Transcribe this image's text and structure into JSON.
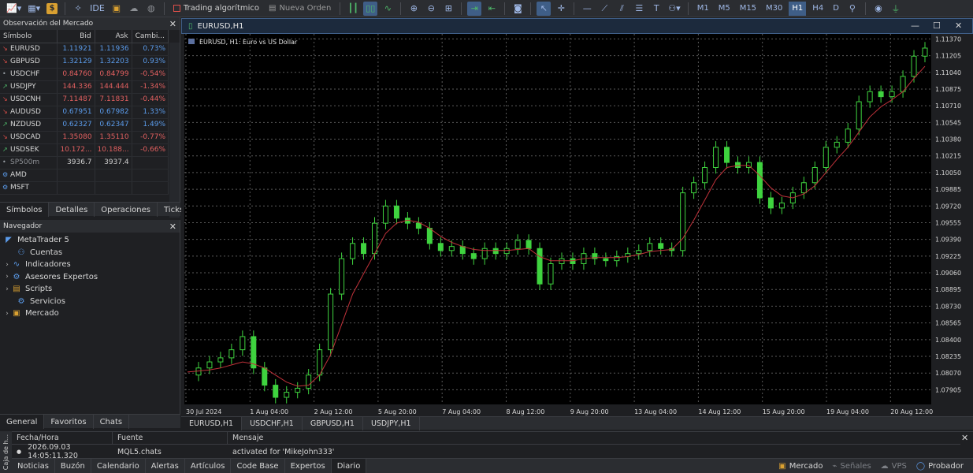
{
  "toolbar": {
    "algo_trading": "Trading algorítmico",
    "new_order": "Nueva Orden",
    "ide_label": "IDE",
    "timeframes": [
      "M1",
      "M5",
      "M15",
      "M30",
      "H1",
      "H4",
      "D"
    ],
    "active_timeframe": "H1"
  },
  "market_watch": {
    "title": "Observación del Mercado",
    "columns": [
      "Símbolo",
      "Bid",
      "Ask",
      "Cambi..."
    ],
    "rows": [
      {
        "symbol": "EURUSD",
        "dir": "down",
        "bid": "1.11921",
        "ask": "1.11936",
        "change": "0.73%",
        "color": "blue"
      },
      {
        "symbol": "GBPUSD",
        "dir": "down",
        "bid": "1.32129",
        "ask": "1.32203",
        "change": "0.93%",
        "color": "blue"
      },
      {
        "symbol": "USDCHF",
        "dir": "dot",
        "bid": "0.84760",
        "ask": "0.84799",
        "change": "-0.54%",
        "color": "red"
      },
      {
        "symbol": "USDJPY",
        "dir": "up",
        "bid": "144.336",
        "ask": "144.444",
        "change": "-1.34%",
        "color": "red"
      },
      {
        "symbol": "USDCNH",
        "dir": "down",
        "bid": "7.11487",
        "ask": "7.11831",
        "change": "-0.44%",
        "color": "red"
      },
      {
        "symbol": "AUDUSD",
        "dir": "down",
        "bid": "0.67951",
        "ask": "0.67982",
        "change": "1.33%",
        "color": "blue"
      },
      {
        "symbol": "NZDUSD",
        "dir": "up",
        "bid": "0.62327",
        "ask": "0.62347",
        "change": "1.49%",
        "color": "blue"
      },
      {
        "symbol": "USDCAD",
        "dir": "down",
        "bid": "1.35080",
        "ask": "1.35110",
        "change": "-0.77%",
        "color": "red"
      },
      {
        "symbol": "USDSEK",
        "dir": "up",
        "bid": "10.172...",
        "ask": "10.188...",
        "change": "-0.66%",
        "color": "red"
      },
      {
        "symbol": "SP500m",
        "dir": "dot",
        "bid": "3936.7",
        "ask": "3937.4",
        "change": "",
        "color": "gray"
      },
      {
        "symbol": "AMD",
        "dir": "circle",
        "bid": "",
        "ask": "",
        "change": "",
        "color": "gray"
      },
      {
        "symbol": "MSFT",
        "dir": "circle",
        "bid": "",
        "ask": "",
        "change": "",
        "color": "gray"
      }
    ],
    "tabs": [
      "Símbolos",
      "Detalles",
      "Operaciones",
      "Ticks"
    ]
  },
  "navigator": {
    "title": "Navegador",
    "root": "MetaTrader 5",
    "items": [
      "Cuentas",
      "Indicadores",
      "Asesores Expertos",
      "Scripts",
      "Servicios",
      "Mercado"
    ],
    "tabs": [
      "General",
      "Favoritos",
      "Chats"
    ]
  },
  "chart": {
    "window_title": "EURUSD,H1",
    "legend": "EURUSD, H1:  Euro vs US Dollar",
    "tabs": [
      "EURUSD,H1",
      "USDCHF,H1",
      "GBPUSD,H1",
      "USDJPY,H1"
    ],
    "candle_color": "#3fd33f",
    "ma_color": "#c0323a"
  },
  "chart_data": {
    "type": "line",
    "title": "",
    "x_tick_labels": [
      "30 Jul 2024",
      "1 Aug 04:00",
      "2 Aug 12:00",
      "5 Aug 20:00",
      "7 Aug 04:00",
      "8 Aug 12:00",
      "9 Aug 20:00",
      "13 Aug 04:00",
      "14 Aug 12:00",
      "15 Aug 20:00",
      "19 Aug 04:00",
      "20 Aug 12:00"
    ],
    "y_tick_labels": [
      "1.11370",
      "1.11205",
      "1.11040",
      "1.10875",
      "1.10710",
      "1.10545",
      "1.10380",
      "1.10215",
      "1.10050",
      "1.09885",
      "1.09720",
      "1.09555",
      "1.09390",
      "1.09225",
      "1.09060",
      "1.08895",
      "1.08730",
      "1.08565",
      "1.08400",
      "1.08235",
      "1.08070",
      "1.07905"
    ],
    "ylim": [
      1.0776,
      1.1142
    ],
    "grid": true,
    "series": [
      {
        "values": [
          1.0805,
          1.0812,
          1.0818,
          1.0822,
          1.083,
          1.0843,
          1.0812,
          1.0795,
          1.0783,
          1.0788,
          1.0792,
          1.0805,
          1.083,
          1.0885,
          1.092,
          1.0935,
          1.0925,
          1.0955,
          1.0972,
          1.096,
          1.0955,
          1.095,
          1.0935,
          1.0928,
          1.0932,
          1.0925,
          1.092,
          1.093,
          1.0925,
          1.093,
          1.0938,
          1.093,
          1.0895,
          1.0915,
          1.092,
          1.0915,
          1.0925,
          1.092,
          1.0918,
          1.0922,
          1.0925,
          1.0928,
          1.0935,
          1.093,
          1.0928,
          1.0985,
          1.0995,
          1.101,
          1.103,
          1.1015,
          1.101,
          1.1015,
          1.098,
          1.097,
          1.0975,
          1.0985,
          1.0995,
          1.101,
          1.103,
          1.1035,
          1.1048,
          1.1075,
          1.1085,
          1.108,
          1.1085,
          1.11,
          1.112,
          1.1128
        ]
      },
      {
        "values": [
          1.0808,
          1.0809,
          1.081,
          1.0812,
          1.0815,
          1.0818,
          1.0816,
          1.0812,
          1.0805,
          1.0798,
          1.0794,
          1.0795,
          1.0805,
          1.0825,
          1.0855,
          1.0885,
          1.0905,
          1.0925,
          1.0945,
          1.0955,
          1.0958,
          1.0956,
          1.095,
          1.0942,
          1.0936,
          1.0932,
          1.0929,
          1.0928,
          1.0928,
          1.0928,
          1.0929,
          1.093,
          1.0922,
          1.0918,
          1.0918,
          1.0918,
          1.092,
          1.0921,
          1.0921,
          1.0921,
          1.0922,
          1.0924,
          1.0927,
          1.0928,
          1.0929,
          1.094,
          1.0958,
          1.0978,
          1.0998,
          1.101,
          1.1012,
          1.1012,
          1.1002,
          1.099,
          1.0982,
          1.098,
          1.0984,
          1.0992,
          1.1005,
          1.1018,
          1.103,
          1.1045,
          1.106,
          1.107,
          1.1077,
          1.1085,
          1.1098,
          1.111
        ]
      }
    ]
  },
  "toolbox": {
    "side_label": "Caja de h...",
    "columns": [
      "Fecha/Hora",
      "Fuente",
      "Mensaje"
    ],
    "row": {
      "time": "2026.09.03 14:05:11.320",
      "source": "MQL5.chats",
      "message": "activated for 'MikeJohn333'"
    },
    "tabs": [
      "Noticias",
      "Buzón",
      "Calendario",
      "Alertas",
      "Artículos",
      "Code Base",
      "Expertos",
      "Diario"
    ],
    "active_tab": "Diario",
    "status": [
      "Mercado",
      "Señales",
      "VPS",
      "Probador"
    ]
  }
}
